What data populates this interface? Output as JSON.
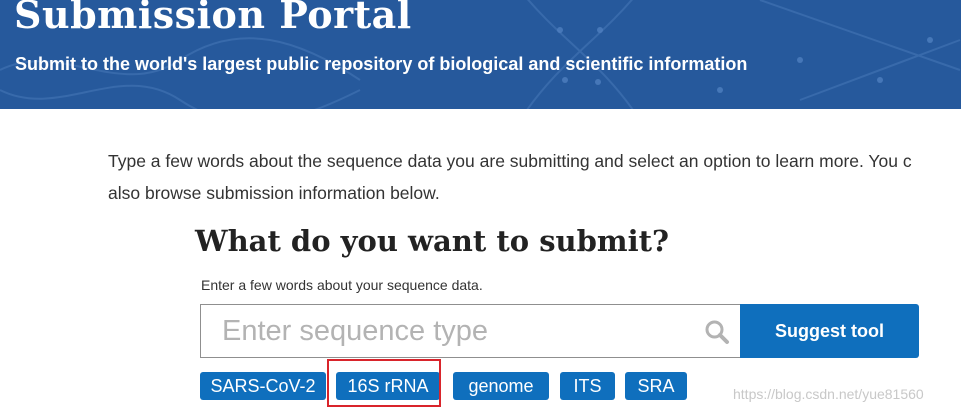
{
  "banner": {
    "title": "Submission Portal",
    "subtitle": "Submit to the world's largest public repository of biological and scientific information"
  },
  "intro": {
    "line1": "Type a few words about the sequence data you are submitting and select an option to learn more. You c",
    "line2": "also browse submission information below."
  },
  "submit": {
    "question": "What do you want to submit?",
    "hint": "Enter a few words about your sequence data.",
    "search": {
      "placeholder": "Enter sequence type",
      "value": ""
    },
    "suggest_label": "Suggest tool"
  },
  "suggestions": [
    {
      "label": "SARS-CoV-2"
    },
    {
      "label": "16S rRNA",
      "highlighted": true
    },
    {
      "label": "genome"
    },
    {
      "label": "ITS"
    },
    {
      "label": "SRA"
    }
  ],
  "watermark": "https://blog.csdn.net/yue81560",
  "colors": {
    "banner_bg": "#26599c",
    "button_bg": "#0f6fbd",
    "highlight_border": "#d9242b"
  },
  "icons": {
    "search": "search-icon"
  }
}
